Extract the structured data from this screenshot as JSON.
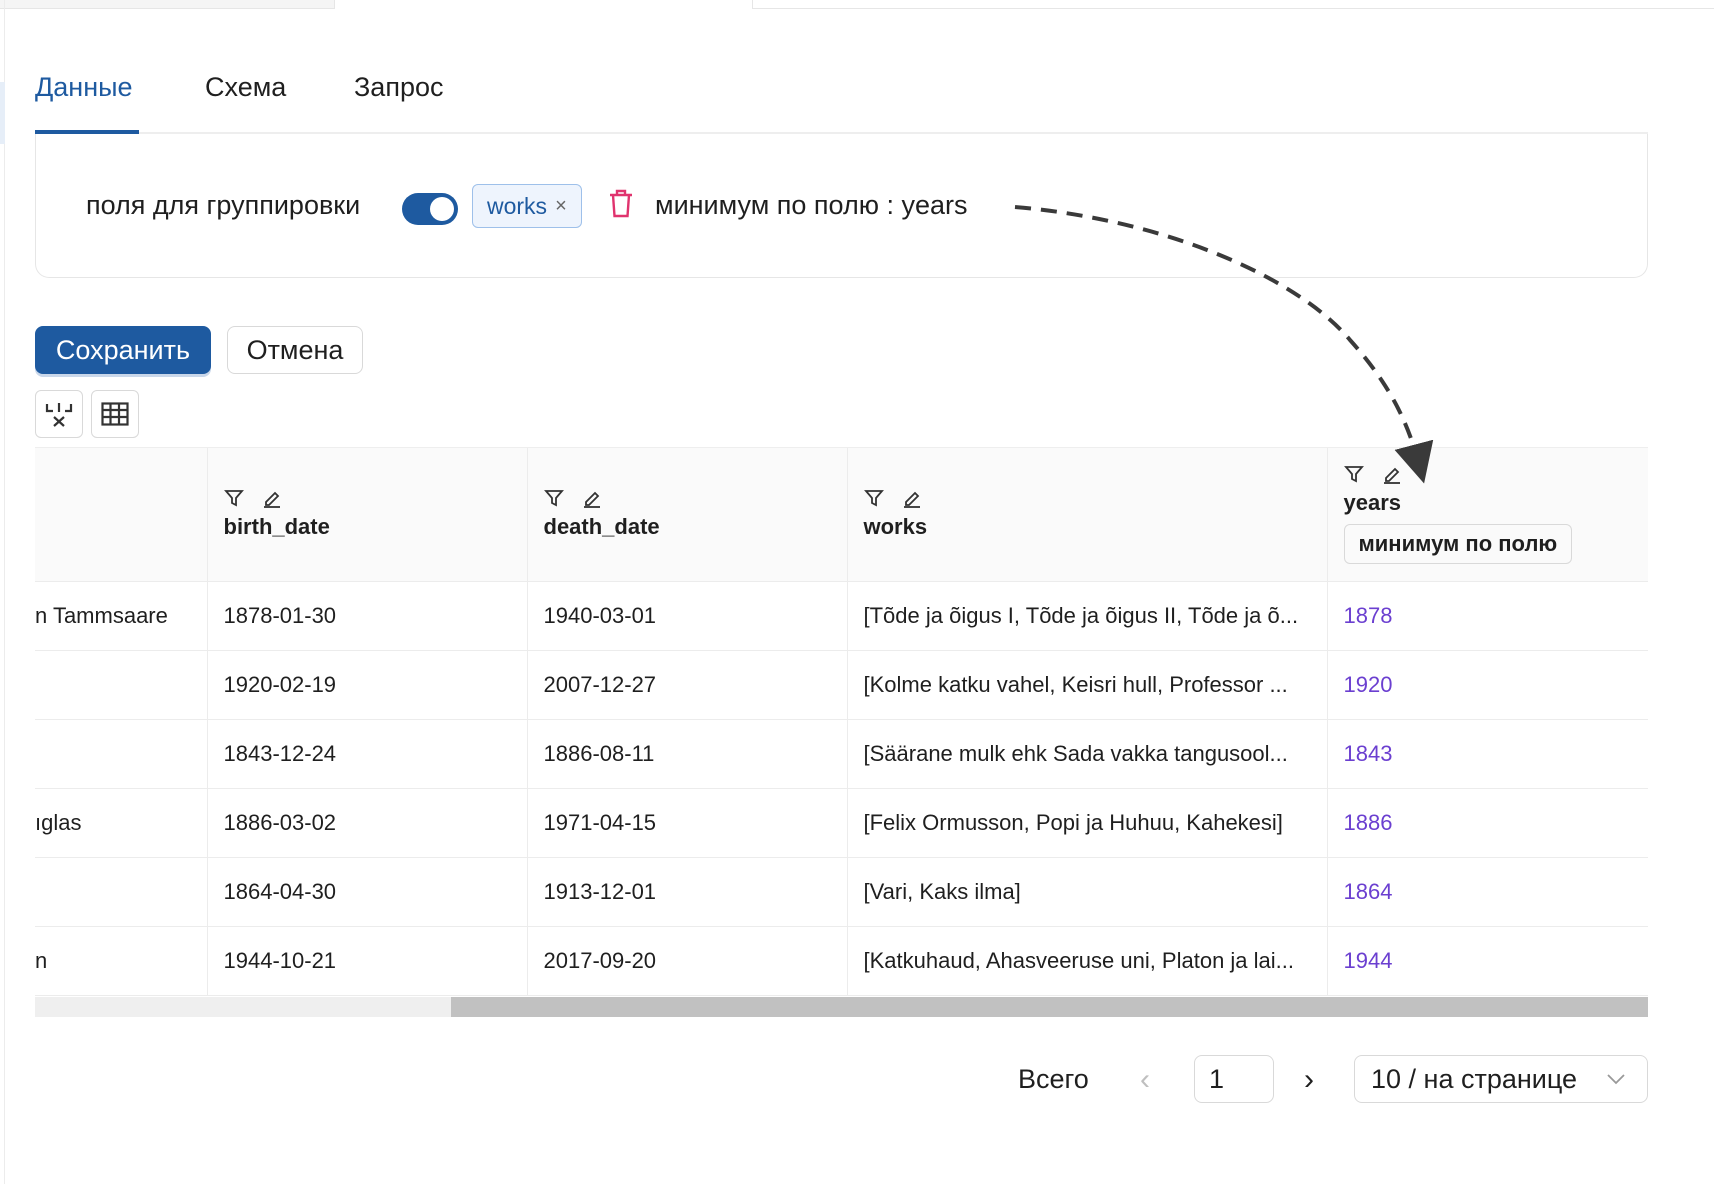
{
  "tabs": [
    {
      "label": "Данные",
      "active": true
    },
    {
      "label": "Схема",
      "active": false
    },
    {
      "label": "Запрос",
      "active": false
    }
  ],
  "grouping": {
    "label": "поля для группировки",
    "toggle_on": true,
    "tag": "works",
    "tag_close": "×",
    "aggregation_label": "минимум по полю : years"
  },
  "actions": {
    "save": "Сохранить",
    "cancel": "Отмена"
  },
  "table": {
    "columns": [
      {
        "key": "name",
        "label": ""
      },
      {
        "key": "birth_date",
        "label": "birth_date"
      },
      {
        "key": "death_date",
        "label": "death_date"
      },
      {
        "key": "works",
        "label": "works"
      },
      {
        "key": "years",
        "label": "years",
        "aggregation_chip": "минимум по полю"
      }
    ],
    "rows": [
      {
        "name": "n Tammsaare",
        "birth_date": "1878-01-30",
        "death_date": "1940-03-01",
        "works": "[Tõde ja õigus I, Tõde ja õigus II, Tõde ja õ...",
        "years": "1878"
      },
      {
        "name": "",
        "birth_date": "1920-02-19",
        "death_date": "2007-12-27",
        "works": "[Kolme katku vahel, Keisri hull, Professor ...",
        "years": "1920"
      },
      {
        "name": "",
        "birth_date": "1843-12-24",
        "death_date": "1886-08-11",
        "works": "[Säärane mulk ehk Sada vakka tangusool...",
        "years": "1843"
      },
      {
        "name": "ıglas",
        "birth_date": "1886-03-02",
        "death_date": "1971-04-15",
        "works": "[Felix Ormusson, Popi ja Huhuu, Kahekesi]",
        "years": "1886"
      },
      {
        "name": "",
        "birth_date": "1864-04-30",
        "death_date": "1913-12-01",
        "works": "[Vari, Kaks ilma]",
        "years": "1864"
      },
      {
        "name": "n",
        "birth_date": "1944-10-21",
        "death_date": "2017-09-20",
        "works": "[Katkuhaud, Ahasveeruse uni, Platon ja lai...",
        "years": "1944"
      }
    ]
  },
  "pagination": {
    "total_label": "Всего",
    "current_page": "1",
    "page_size": "10 / на странице"
  },
  "colors": {
    "accent": "#1e5aa0",
    "years_value": "#6b3fd0",
    "trash": "#e0336e"
  },
  "icons": [
    "filter-icon",
    "edit-icon",
    "trash-icon",
    "formula-icon",
    "table-icon",
    "chevron-left-icon",
    "chevron-right-icon",
    "chevron-down-icon",
    "close-icon"
  ]
}
